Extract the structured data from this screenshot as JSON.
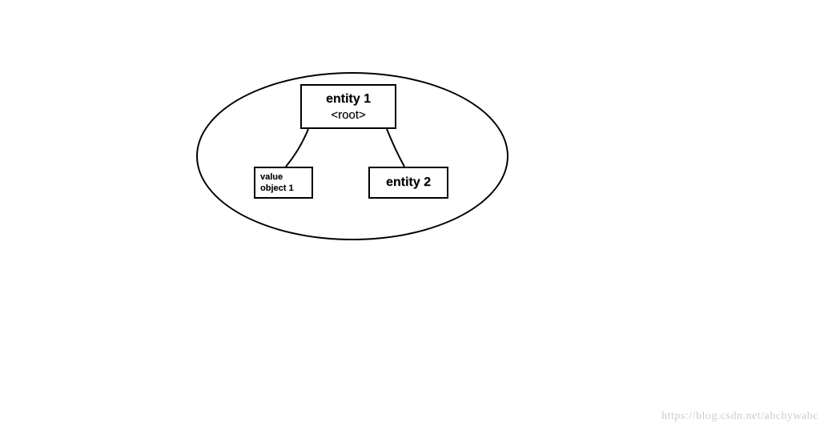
{
  "diagram": {
    "root": {
      "title": "entity 1",
      "subtitle": "<root>"
    },
    "valueObject": {
      "line1": "value",
      "line2": "object 1"
    },
    "entity2": {
      "title": "entity 2"
    }
  },
  "watermark": "https://blog.csdn.net/abchywabc"
}
